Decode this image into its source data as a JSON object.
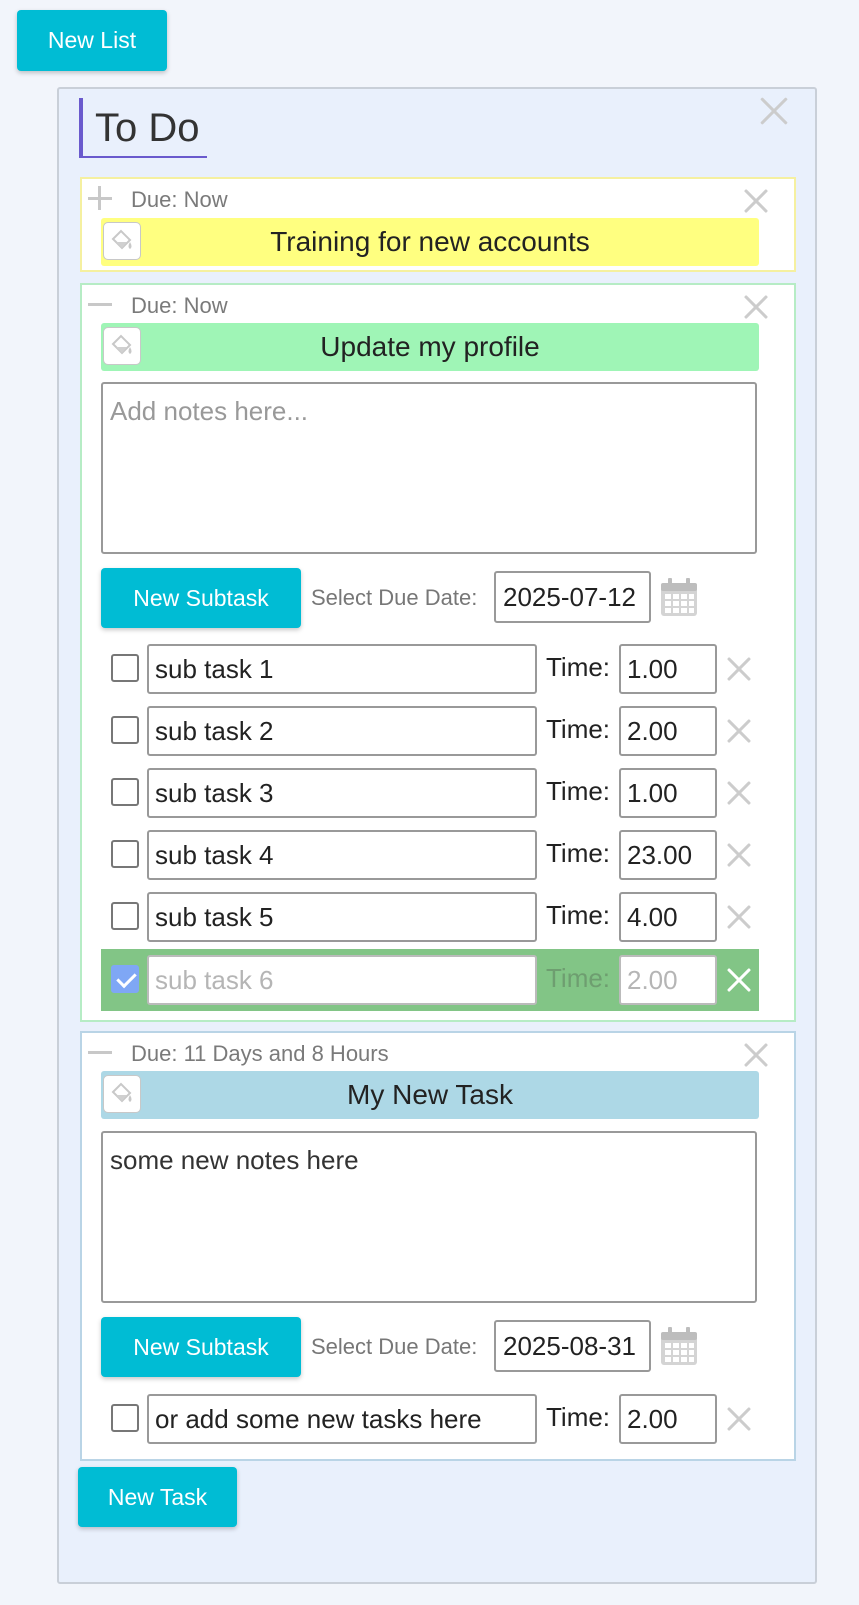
{
  "app": {
    "new_list_label": "New List"
  },
  "list": {
    "title": "To Do",
    "new_task_label": "New Task",
    "tasks": [
      {
        "due": "Due: Now",
        "title": "Training for new accounts",
        "color": "#ffff80",
        "border_color": "#f5f0a0",
        "collapsed": true
      },
      {
        "due": "Due: Now",
        "title": "Update my profile",
        "color": "#9ff5b6",
        "border_color": "#b6ecc5",
        "collapsed": false,
        "notes": "",
        "notes_placeholder": "Add notes here...",
        "new_subtask_label": "New Subtask",
        "due_date_label": "Select Due Date:",
        "due_date": "2025-07-12",
        "time_label": "Time:",
        "subtasks": [
          {
            "name": "sub task 1",
            "time": "1.00",
            "done": false
          },
          {
            "name": "sub task 2",
            "time": "2.00",
            "done": false
          },
          {
            "name": "sub task 3",
            "time": "1.00",
            "done": false
          },
          {
            "name": "sub task 4",
            "time": "23.00",
            "done": false
          },
          {
            "name": "sub task 5",
            "time": "4.00",
            "done": false
          },
          {
            "name": "sub task 6",
            "time": "2.00",
            "done": true
          }
        ]
      },
      {
        "due": "Due: 11 Days and 8 Hours",
        "title": "My New Task",
        "color": "#add8e6",
        "border_color": "#b9d4e6",
        "collapsed": false,
        "notes": "some new notes here",
        "notes_placeholder": "Add notes here...",
        "new_subtask_label": "New Subtask",
        "due_date_label": "Select Due Date:",
        "due_date": "2025-08-31",
        "time_label": "Time:",
        "subtasks": [
          {
            "name": "or add some new tasks here",
            "time": "2.00",
            "done": false
          }
        ]
      }
    ]
  },
  "colors": {
    "button": "#00bcd4",
    "list_accent": "#6a5acd",
    "done_row": "#82c586",
    "checkbox_checked": "#7fa7f5"
  },
  "icons": {
    "paint": "paint-bucket-icon",
    "calendar": "calendar-icon",
    "close": "close-icon",
    "expand": "plus-icon",
    "collapse": "minus-icon"
  }
}
